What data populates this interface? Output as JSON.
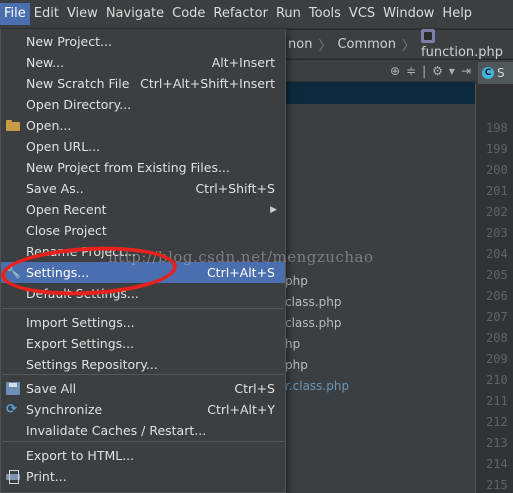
{
  "menubar": {
    "items": [
      {
        "label": "File",
        "active": true
      },
      {
        "label": "Edit"
      },
      {
        "label": "View"
      },
      {
        "label": "Navigate"
      },
      {
        "label": "Code"
      },
      {
        "label": "Refactor"
      },
      {
        "label": "Run"
      },
      {
        "label": "Tools"
      },
      {
        "label": "VCS"
      },
      {
        "label": "Window"
      },
      {
        "label": "Help"
      }
    ]
  },
  "navbar": {
    "crumb1": "non",
    "crumb2": "Common",
    "crumb3": "function.php"
  },
  "project_tree": {
    "rows": [
      "php",
      "class.php",
      "class.php",
      "hp",
      "php",
      "r.class.php"
    ]
  },
  "editor": {
    "tab_label": "S",
    "line_numbers": [
      "198",
      "199",
      "200",
      "201",
      "202",
      "203",
      "204",
      "205",
      "206",
      "207",
      "208",
      "209",
      "210",
      "211",
      "212",
      "213",
      "214",
      "215"
    ]
  },
  "file_menu": {
    "items": [
      {
        "label": "New Project...",
        "shortcut": ""
      },
      {
        "label": "New...",
        "shortcut": "Alt+Insert"
      },
      {
        "label": "New Scratch File",
        "shortcut": "Ctrl+Alt+Shift+Insert"
      },
      {
        "label": "Open Directory...",
        "shortcut": ""
      },
      {
        "label": "Open...",
        "shortcut": "",
        "icon": "folder-icon"
      },
      {
        "label": "Open URL...",
        "shortcut": ""
      },
      {
        "label": "New Project from Existing Files...",
        "shortcut": ""
      },
      {
        "label": "Save As..",
        "shortcut": "Ctrl+Shift+S"
      },
      {
        "label": "Open Recent",
        "shortcut": "",
        "submenu": true
      },
      {
        "label": "Close Project",
        "shortcut": ""
      },
      {
        "label": "Rename Project...",
        "shortcut": ""
      },
      {
        "label": "Settings...",
        "shortcut": "Ctrl+Alt+S",
        "icon": "wrench-icon",
        "selected": true
      },
      {
        "label": "Default Settings...",
        "shortcut": ""
      },
      {
        "label": "Import Settings...",
        "shortcut": ""
      },
      {
        "label": "Export Settings...",
        "shortcut": ""
      },
      {
        "label": "Settings Repository...",
        "shortcut": ""
      },
      {
        "label": "Save All",
        "shortcut": "Ctrl+S",
        "icon": "save-icon"
      },
      {
        "label": "Synchronize",
        "shortcut": "Ctrl+Alt+Y",
        "icon": "sync-icon"
      },
      {
        "label": "Invalidate Caches / Restart...",
        "shortcut": ""
      },
      {
        "label": "Export to HTML...",
        "shortcut": ""
      },
      {
        "label": "Print...",
        "shortcut": "",
        "icon": "print-icon"
      }
    ]
  },
  "watermark": "http://blog.csdn.net/mengzuchao",
  "colors": {
    "menu_bg": "#3c3f41",
    "selection": "#4b6eaf",
    "highlight_ring": "#e8211c",
    "editor_bg": "#2b2b2b"
  }
}
